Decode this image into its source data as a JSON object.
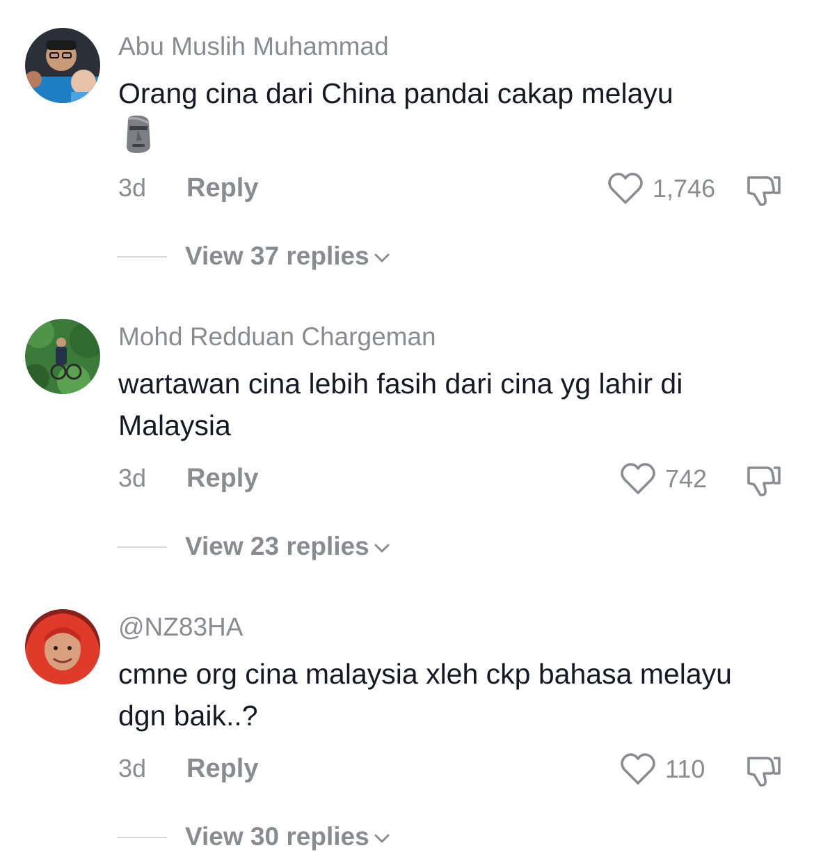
{
  "comments": [
    {
      "username": "Abu Muslih Muhammad",
      "text": "Orang cina dari China pandai cakap melayu",
      "emoji": "moai",
      "time": "3d",
      "reply_label": "Reply",
      "likes": "1,746",
      "view_replies": "View 37 replies"
    },
    {
      "username": "Mohd Redduan Chargeman",
      "text": "wartawan cina lebih fasih dari cina yg lahir di Malaysia",
      "time": "3d",
      "reply_label": "Reply",
      "likes": "742",
      "view_replies": "View 23 replies"
    },
    {
      "username": "@NZ83HA",
      "text": "cmne org cina malaysia xleh ckp bahasa melayu dgn baik..?",
      "time": "3d",
      "reply_label": "Reply",
      "likes": "110",
      "view_replies": "View 30 replies"
    }
  ],
  "icons": {
    "like": "heart-outline-icon",
    "dislike": "thumbs-down-icon",
    "expand": "chevron-down-icon"
  },
  "colors": {
    "text": "#161823",
    "muted": "#8a8b91",
    "divider": "#d6d7da"
  }
}
